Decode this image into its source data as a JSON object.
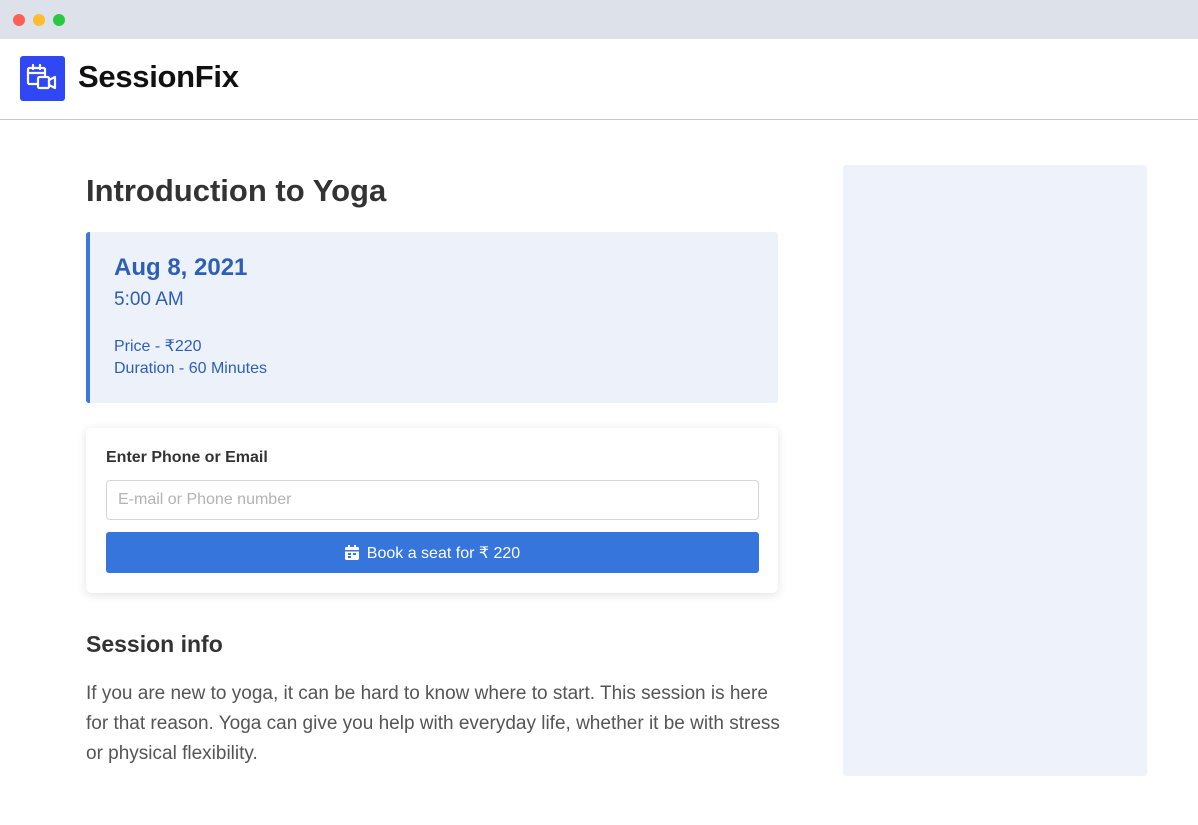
{
  "app": {
    "brand": "SessionFix"
  },
  "session": {
    "title": "Introduction to Yoga",
    "date": "Aug 8, 2021",
    "time": "5:00 AM",
    "price": "Price - ₹220",
    "duration": "Duration - 60 Minutes"
  },
  "booking": {
    "label": "Enter Phone or Email",
    "input_value": "",
    "input_placeholder": "E-mail or Phone number",
    "button_label": "Book a seat for ₹ 220"
  },
  "info": {
    "heading": "Session info",
    "description": "If you are new to yoga, it can be hard to know where to start. This session is here for that reason. Yoga can give you help with everyday life, whether it be with stress or physical flexibility."
  },
  "icons": {
    "logo": "calendar-video-icon",
    "book_button": "calendar-icon"
  },
  "colors": {
    "brand": "#2f47f5",
    "accent": "#3575dc",
    "info_text": "#2e5fb6",
    "info_background": "#ecf1fa"
  }
}
